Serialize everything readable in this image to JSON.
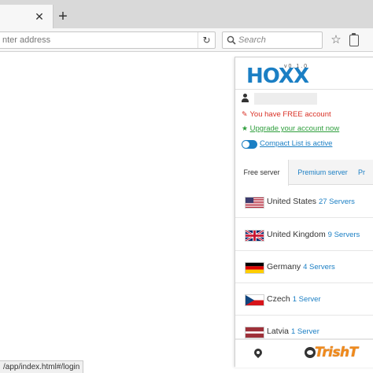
{
  "browser": {
    "urlbar": {
      "placeholder": "nter address"
    },
    "searchbar": {
      "placeholder": "Search"
    },
    "status_url": "/app/index.html#/login"
  },
  "extension": {
    "logo_text": "HOXX",
    "version": "v0.1.0",
    "account_status": "You have FREE account",
    "upgrade_label": "Upgrade your account now",
    "compact_label": "Compact List is active",
    "tabs": [
      {
        "label": "Free server"
      },
      {
        "label": "Premium server"
      },
      {
        "label": "Pr"
      }
    ],
    "servers": [
      {
        "name": "United States",
        "count": "27 Servers",
        "flag": "us"
      },
      {
        "name": "United Kingdom",
        "count": "9 Servers",
        "flag": "uk"
      },
      {
        "name": "Germany",
        "count": "4 Servers",
        "flag": "de"
      },
      {
        "name": "Czech",
        "count": "1 Server",
        "flag": "cz"
      },
      {
        "name": "Latvia",
        "count": "1 Server",
        "flag": "lv"
      }
    ]
  },
  "colors": {
    "brand_blue": "#1b7fc4",
    "free_red": "#d93025",
    "upgrade_green": "#2e9e3c"
  },
  "icons": [
    "close-icon",
    "plus-icon",
    "reload-icon",
    "search-icon",
    "star-icon",
    "clipboard-icon",
    "user-icon",
    "location-pin-icon",
    "face-icon",
    "toggle-switch"
  ],
  "watermark_text": "TrishT"
}
